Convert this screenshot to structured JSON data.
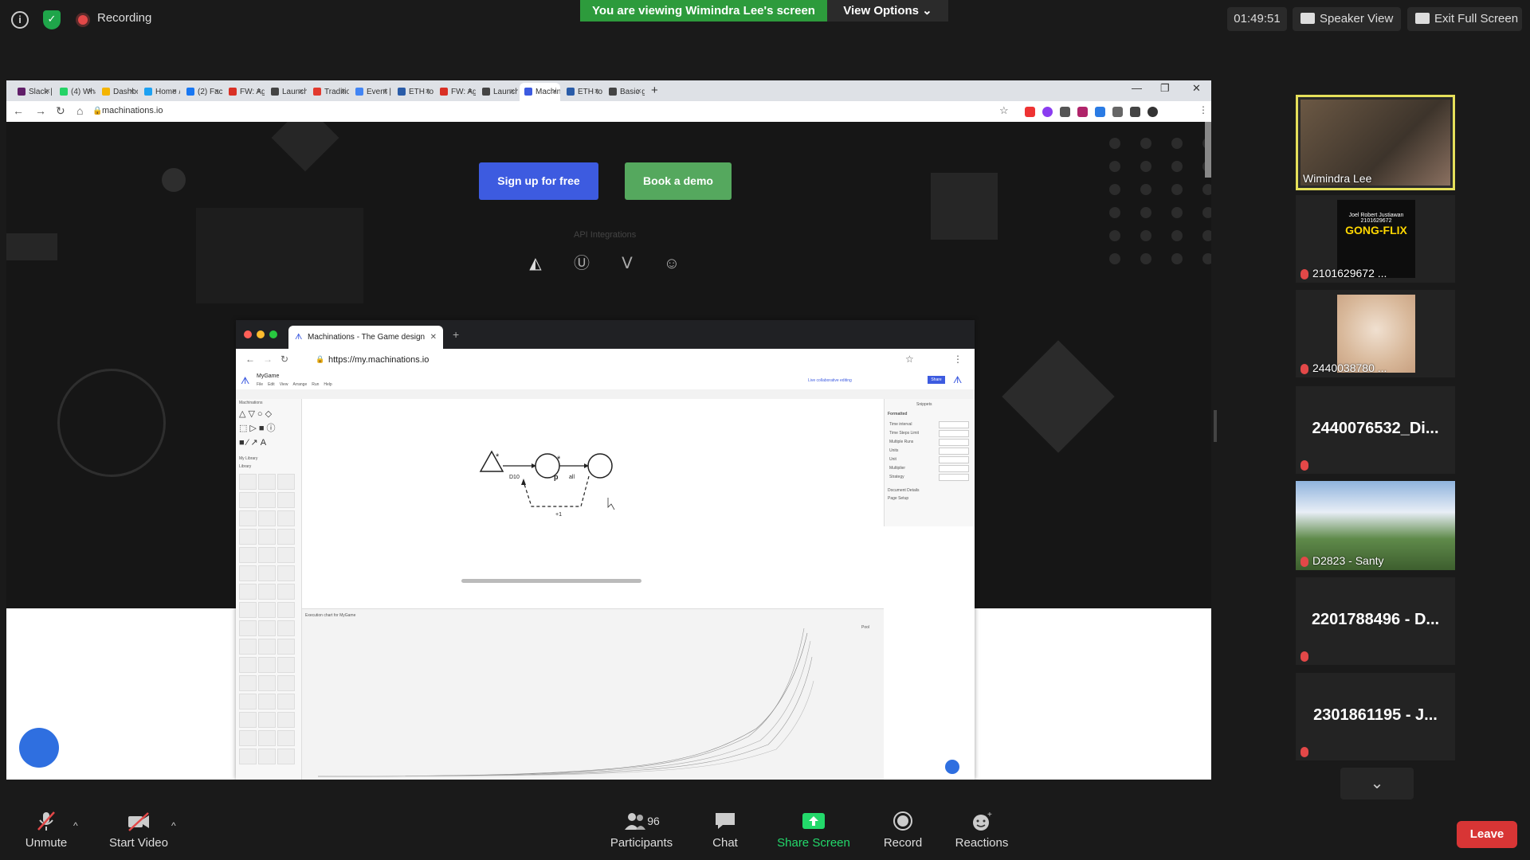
{
  "top": {
    "recording_label": "Recording",
    "viewing_banner": "You are viewing Wimindra Lee's screen",
    "view_options": "View Options ⌄",
    "timer": "01:49:51",
    "speaker_view": "Speaker View",
    "exit_full_screen": "Exit Full Screen"
  },
  "browser": {
    "tabs": [
      {
        "label": "Slack | *",
        "color": "#611f69"
      },
      {
        "label": "(4) What",
        "color": "#25d366"
      },
      {
        "label": "Dashbo",
        "color": "#f4b400"
      },
      {
        "label": "Home /",
        "color": "#1da1f2"
      },
      {
        "label": "(2) Faceb",
        "color": "#1877f2"
      },
      {
        "label": "FW: Aga",
        "color": "#d93025"
      },
      {
        "label": "Launch",
        "color": "#444444"
      },
      {
        "label": "Traditio",
        "color": "#e23a2e"
      },
      {
        "label": "Event |",
        "color": "#4285f4"
      },
      {
        "label": "ETH to",
        "color": "#2a5ca8"
      },
      {
        "label": "FW: Aga",
        "color": "#d93025"
      },
      {
        "label": "Launch",
        "color": "#444444"
      },
      {
        "label": "Machin",
        "color": "#3d5be0"
      },
      {
        "label": "ETH to",
        "color": "#2a5ca8"
      },
      {
        "label": "Basic ga",
        "color": "#444444"
      }
    ],
    "url": "machinations.io",
    "new_tab": "+"
  },
  "site": {
    "signup_label": "Sign up for free",
    "demo_label": "Book a demo",
    "api_label": "API Integrations"
  },
  "embedded": {
    "tab_title": "Machinations - The Game design",
    "url": "https://my.machinations.io",
    "app_title": "MyGame",
    "menu": [
      "File",
      "Edit",
      "View",
      "Arrange",
      "Run",
      "Help"
    ],
    "live_label": "Live collaborative editing",
    "share_label": "Share",
    "left_section": "Machinations",
    "my_library": "My Library",
    "library": "Library",
    "right_title": "Snippets",
    "right_section": "Formatted",
    "right_fields": [
      "Time interval",
      "Time Steps Limit",
      "Multiple Runs",
      "Units",
      "Unit",
      "Multiplier",
      "Strategy"
    ],
    "right_footer": [
      "Document Details",
      "Page Setup"
    ],
    "chart_title": "Execution chart for MyGame",
    "chart_legend": "Pool",
    "diagram": {
      "label_d10": "D10",
      "label_p": "p",
      "label_all": "all",
      "label_plus1": "+1",
      "star": "*"
    }
  },
  "participants": [
    {
      "name": "Wimindra Lee",
      "type": "video",
      "bg": "#5a4a3a"
    },
    {
      "name": "2101629672 ...",
      "type": "image",
      "muted": true,
      "bg": "#111111"
    },
    {
      "name": "2440038780 ...",
      "type": "image",
      "muted": true,
      "bg": "#d8b89a"
    },
    {
      "name": "2440076532_Di...",
      "type": "text",
      "muted": true
    },
    {
      "name": "D2823 - Santy",
      "type": "video",
      "muted": true,
      "bg": "#6a8fb8"
    },
    {
      "name": "2201788496 - D...",
      "type": "text",
      "muted": true
    },
    {
      "name": "2301861195 - J...",
      "type": "text",
      "muted": true
    }
  ],
  "gongflix": {
    "line1": "Joel Robert Justiawan",
    "line2": "2101629672",
    "line3": "GONG-FLIX"
  },
  "toolbar": {
    "unmute": "Unmute",
    "start_video": "Start Video",
    "participants": "Participants",
    "participants_count": "96",
    "chat": "Chat",
    "share_screen": "Share Screen",
    "record": "Record",
    "reactions": "Reactions",
    "leave": "Leave"
  },
  "colors": {
    "share_green": "#23d96b",
    "leave_red": "#d83535",
    "banner_green": "#2d9b3c"
  }
}
